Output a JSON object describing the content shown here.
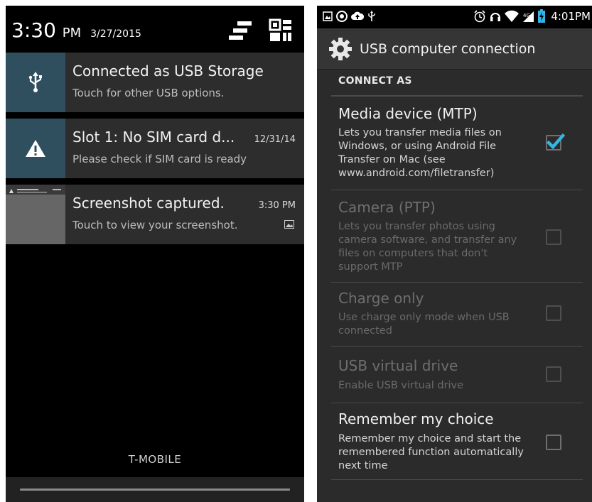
{
  "left": {
    "header": {
      "time": "3:30",
      "ampm": "PM",
      "date": "3/27/2015"
    },
    "notifications": [
      {
        "icon": "usb-icon",
        "title": "Connected as USB Storage",
        "subtitle": "Touch for other USB options.",
        "time": ""
      },
      {
        "icon": "warning-icon",
        "title": "Slot 1: No SIM card d...",
        "subtitle": "Please check if SIM card is ready",
        "time": "12/31/14"
      },
      {
        "icon": "screenshot-thumbnail",
        "title": "Screenshot captured.",
        "subtitle": "Touch to view your screenshot.",
        "time": "3:30 PM"
      }
    ],
    "carrier": "T-MOBILE"
  },
  "right": {
    "status_time": "4:01PM",
    "title": "USB computer connection",
    "section": "CONNECT AS",
    "prefs": [
      {
        "title": "Media device (MTP)",
        "summary": "Lets you transfer media files on Windows, or using Android File Transfer on Mac (see www.android.com/filetransfer)",
        "checked": true,
        "enabled": true
      },
      {
        "title": "Camera (PTP)",
        "summary": "Lets you transfer photos using camera software, and transfer any files on computers that don't support MTP",
        "checked": false,
        "enabled": false
      },
      {
        "title": "Charge only",
        "summary": "Use charge only mode when USB connected",
        "checked": false,
        "enabled": false
      },
      {
        "title": "USB virtual drive",
        "summary": "Enable USB virtual drive",
        "checked": false,
        "enabled": false
      },
      {
        "title": "Remember my choice",
        "summary": "Remember my choice and start the remembered function automatically next time",
        "checked": false,
        "enabled": true
      }
    ]
  },
  "colors": {
    "accent": "#33b5e5",
    "notif_icon_bg": "#2f4f5e"
  }
}
